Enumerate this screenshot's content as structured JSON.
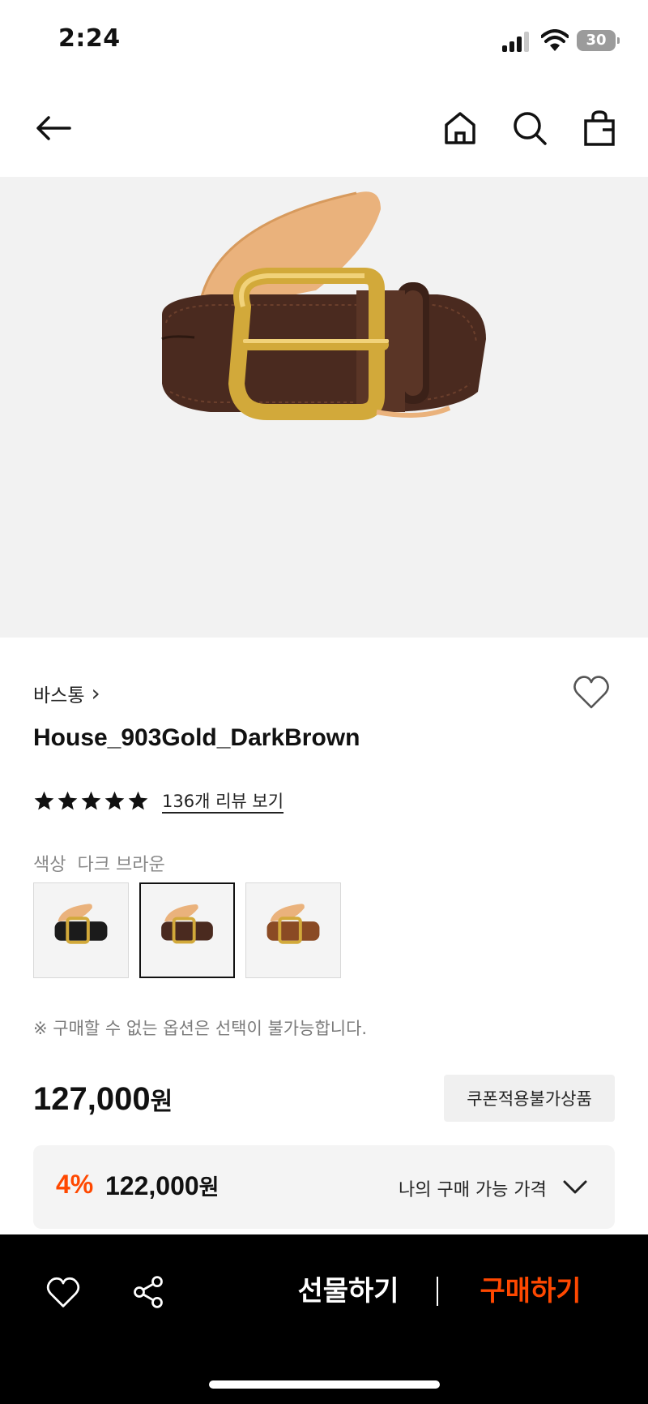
{
  "status_bar": {
    "time": "2:24",
    "battery": "30"
  },
  "nav": {
    "back_icon": "arrow-left-icon",
    "home_icon": "home-icon",
    "search_icon": "search-icon",
    "bag_icon": "shopping-bag-icon"
  },
  "product": {
    "brand": "바스통",
    "brand_chevron": "›",
    "name": "House_903Gold_DarkBrown",
    "rating_stars": 5,
    "review_link": "136개 리뷰 보기",
    "color_label": "색상",
    "color_value": "다크 브라운",
    "swatches": [
      {
        "name": "black",
        "strap": "#1b1b1b",
        "selected": false
      },
      {
        "name": "dark-brown",
        "strap": "#4a2a1f",
        "selected": true
      },
      {
        "name": "brown",
        "strap": "#8a4a24",
        "selected": false
      }
    ],
    "notice": "※ 구매할 수 없는 옵션은 선택이 불가능합니다.",
    "price_number": "127,000",
    "price_unit": "원",
    "coupon_badge": "쿠폰적용불가상품",
    "my_price": {
      "discount": "4%",
      "amount_number": "122,000",
      "amount_unit": "원",
      "label": "나의 구매 가능 가격"
    }
  },
  "bottom_bar": {
    "wish_icon": "heart-icon",
    "share_icon": "share-icon",
    "gift_label": "선물하기",
    "buy_label": "구매하기"
  },
  "colors": {
    "accent": "#ff4800",
    "bar_bg": "#000000",
    "hero_bg": "#f2f2f2",
    "belt_strap": "#4a2a1f",
    "buckle": "#d2a93a",
    "lining": "#eab27c"
  }
}
